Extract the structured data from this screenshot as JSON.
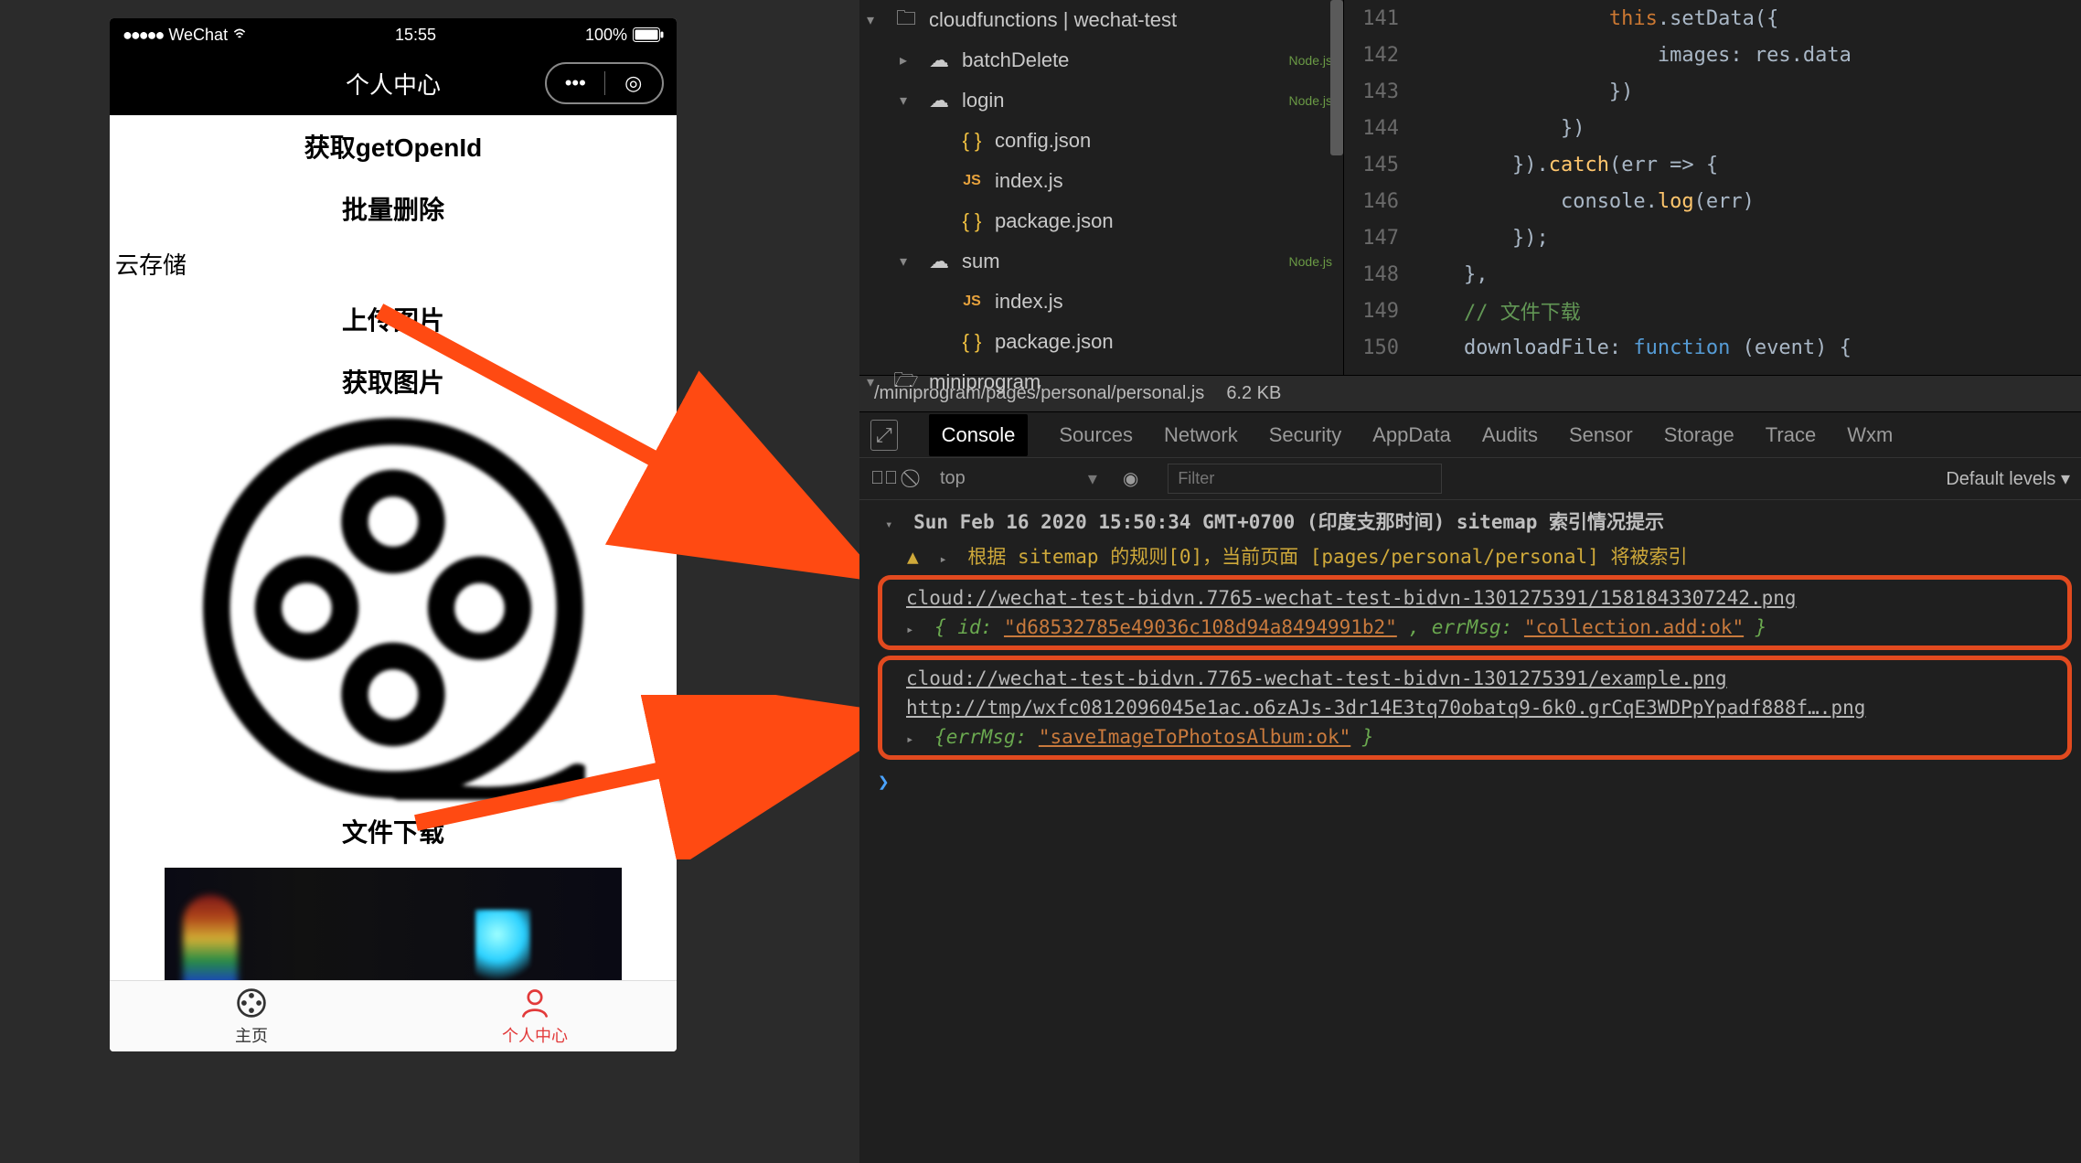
{
  "phone": {
    "status": {
      "carrier": "WeChat",
      "time": "15:55",
      "battery": "100%"
    },
    "title": "个人中心",
    "buttons": {
      "getOpenId": "获取getOpenId",
      "batchDelete": "批量删除",
      "cloudStorage": "云存储",
      "uploadImage": "上传图片",
      "getImage": "获取图片",
      "fileDownload": "文件下载"
    },
    "tabs": {
      "home": "主页",
      "personal": "个人中心"
    }
  },
  "ide": {
    "tree": {
      "root": "cloudfunctions | wechat-test",
      "batchDelete": "batchDelete",
      "login": "login",
      "config": "config.json",
      "indexjs": "index.js",
      "packagejson": "package.json",
      "sum": "sum",
      "miniprogram": "miniprogram",
      "nodeBadge": "Node.js"
    },
    "code": {
      "l141": "141",
      "t141a": "this",
      "t141b": ".setData({",
      "l142": "142",
      "t142": "images: res.data",
      "l143": "143",
      "t143": "})",
      "l144": "144",
      "t144": "})",
      "l145": "145",
      "t145a": "}).",
      "t145b": "catch",
      "t145c": "(err => {",
      "l146": "146",
      "t146a": "console.",
      "t146b": "log",
      "t146c": "(err)",
      "l147": "147",
      "t147": "});",
      "l148": "148",
      "t148": "},",
      "l149": "149",
      "t149": "// 文件下载",
      "l150": "150",
      "t150a": "downloadFile: ",
      "t150b": "function",
      "t150c": " (event) {"
    },
    "pathbar": {
      "path": "/miniprogram/pages/personal/personal.js",
      "size": "6.2 KB"
    }
  },
  "devtools": {
    "tabs": {
      "console": "Console",
      "sources": "Sources",
      "network": "Network",
      "security": "Security",
      "appdata": "AppData",
      "audits": "Audits",
      "sensor": "Sensor",
      "storage": "Storage",
      "trace": "Trace",
      "wxm": "Wxm"
    },
    "toolbar": {
      "context": "top",
      "filterPlaceholder": "Filter",
      "levels": "Default levels ▾"
    },
    "console": {
      "group": "Sun Feb 16 2020 15:50:34 GMT+0700 (印度支那时间) sitemap 索引情况提示",
      "warn": "根据 sitemap 的规则[0]，当前页面 [pages/personal/personal] 将被索引",
      "url1": "cloud://wechat-test-bidvn.7765-wechat-test-bidvn-1301275391/1581843307242.png",
      "obj1a": "{ id: ",
      "obj1b": "\"d68532785e49036c108d94a8494991b2\"",
      "obj1c": ", errMsg: ",
      "obj1d": "\"collection.add:ok\"",
      "obj1e": "}",
      "url2": "cloud://wechat-test-bidvn.7765-wechat-test-bidvn-1301275391/example.png",
      "url3": "http://tmp/wxfc0812096045e1ac.o6zAJs-3dr14E3tq70obatq9-6k0.grCqE3WDPpYpadf888f….png",
      "obj2a": "{errMsg: ",
      "obj2b": "\"saveImageToPhotosAlbum:ok\"",
      "obj2c": "}"
    }
  }
}
